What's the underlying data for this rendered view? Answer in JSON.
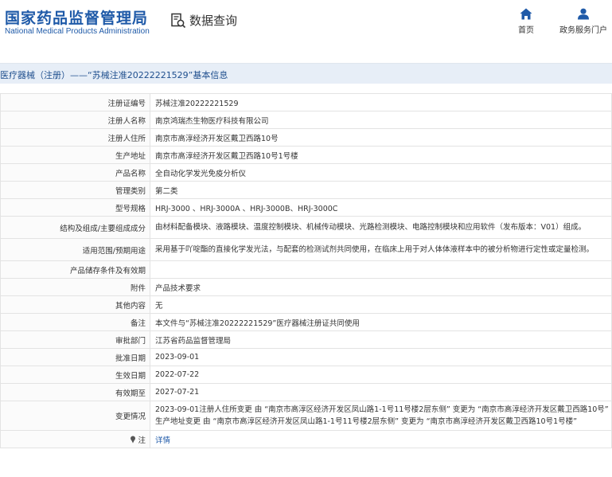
{
  "header": {
    "logo_cn": "国家药品监督管理局",
    "logo_en": "National Medical Products Administration",
    "query_title": "数据查询",
    "nav": {
      "home": "首页",
      "gov": "政务服务门户"
    }
  },
  "title_bar": "医疗器械（注册）——“苏械注准20222221529”基本信息",
  "fields": [
    {
      "label": "注册证编号",
      "value": "苏械注准20222221529"
    },
    {
      "label": "注册人名称",
      "value": "南京鸿瑞杰生物医疗科技有限公司"
    },
    {
      "label": "注册人住所",
      "value": "南京市高淳经济开发区戴卫西路10号"
    },
    {
      "label": "生产地址",
      "value": "南京市高淳经济开发区戴卫西路10号1号楼"
    },
    {
      "label": "产品名称",
      "value": "全自动化学发光免疫分析仪"
    },
    {
      "label": "管理类别",
      "value": "第二类"
    },
    {
      "label": "型号规格",
      "value": "HRJ-3000 、HRJ-3000A 、HRJ-3000B、HRJ-3000C"
    },
    {
      "label": "结构及组成/主要组成成分",
      "value": "由材料配备模块、液路模块、温度控制模块、机械传动模块、光路检测模块、电路控制模块和应用软件（发布版本：V01）组成。"
    },
    {
      "label": "适用范围/预期用途",
      "value": "采用基于吖啶酯的直接化学发光法，与配套的检测试剂共同使用，在临床上用于对人体体液样本中的被分析物进行定性或定量检测。"
    },
    {
      "label": "产品储存条件及有效期",
      "value": ""
    },
    {
      "label": "附件",
      "value": "产品技术要求"
    },
    {
      "label": "其他内容",
      "value": "无"
    },
    {
      "label": "备注",
      "value": "本文件与“苏械注准20222221529”医疗器械注册证共同使用"
    },
    {
      "label": "审批部门",
      "value": "江苏省药品监督管理局"
    },
    {
      "label": "批准日期",
      "value": "2023-09-01"
    },
    {
      "label": "生效日期",
      "value": "2022-07-22"
    },
    {
      "label": "有效期至",
      "value": "2027-07-21"
    },
    {
      "label": "变更情况",
      "value": "2023-09-01注册人住所变更 由 “南京市高淳区经济开发区凤山路1-1号11号楼2层东侧” 变更为 “南京市高淳经济开发区戴卫西路10号” 生产地址变更 由 “南京市高淳区经济开发区凤山路1-1号11号楼2层东侧” 变更为 “南京市高淳经济开发区戴卫西路10号1号楼”"
    },
    {
      "label": "注",
      "value": "详情"
    }
  ],
  "colors": {
    "brand": "#1f5aa8",
    "title_bg": "#e7eef7"
  }
}
